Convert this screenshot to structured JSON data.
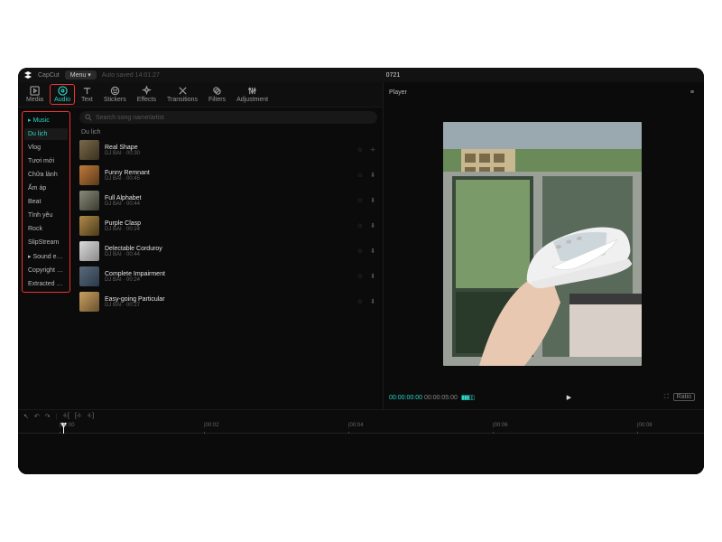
{
  "app_name": "CapCut",
  "menu_label": "Menu ▾",
  "autosave": "Auto saved 14:01:27",
  "project_title": "0721",
  "tabs": [
    {
      "id": "media",
      "label": "Media"
    },
    {
      "id": "audio",
      "label": "Audio"
    },
    {
      "id": "text",
      "label": "Text"
    },
    {
      "id": "stickers",
      "label": "Stickers"
    },
    {
      "id": "effects",
      "label": "Effects"
    },
    {
      "id": "transitions",
      "label": "Transitions"
    },
    {
      "id": "filters",
      "label": "Filters"
    },
    {
      "id": "adjustment",
      "label": "Adjustment"
    }
  ],
  "sidebar": {
    "music_header": "▸ Music",
    "categories": [
      "Du lịch",
      "Vlog",
      "Tươi mới",
      "Chữa lành",
      "Ấm áp",
      "Beat",
      "Tình yêu",
      "Rock",
      "SlipStream"
    ],
    "extras": [
      "▸ Sound effe...",
      "Copyright c...",
      "Extracted a..."
    ]
  },
  "search_placeholder": "Search song name/artist",
  "list_title": "Du lịch",
  "tracks": [
    {
      "name": "Real Shape",
      "artist": "DJ BAI",
      "dur": "00:30",
      "c1": "#7a6a4a",
      "c2": "#3a3020"
    },
    {
      "name": "Funny Remnant",
      "artist": "DJ BAI",
      "dur": "00:45",
      "c1": "#c07a3a",
      "c2": "#5a3a1a"
    },
    {
      "name": "Full Alphabet",
      "artist": "DJ BAI",
      "dur": "00:44",
      "c1": "#8a8a7a",
      "c2": "#3a3a30"
    },
    {
      "name": "Purple Clasp",
      "artist": "DJ BAI",
      "dur": "00:24",
      "c1": "#b08a4a",
      "c2": "#4a3a1a"
    },
    {
      "name": "Delectable Corduroy",
      "artist": "DJ BAI",
      "dur": "00:44",
      "c1": "#dadada",
      "c2": "#8a8a8a"
    },
    {
      "name": "Complete Impairment",
      "artist": "DJ BAI",
      "dur": "00:24",
      "c1": "#5a6a7a",
      "c2": "#2a3a4a"
    },
    {
      "name": "Easy-going Particular",
      "artist": "DJ BAI",
      "dur": "00:27",
      "c1": "#caa060",
      "c2": "#6a5030"
    }
  ],
  "player": {
    "label": "Player",
    "tc_cur": "00:00:00:00",
    "tc_dur": "00:00:05:00",
    "ratio": "Ratio"
  },
  "timeline": {
    "ticks": [
      "00:00",
      "00:02",
      "00:04",
      "00:06",
      "00:08"
    ]
  },
  "selected_category": 0,
  "colors": {
    "accent": "#2bd4c5",
    "hl": "#e33"
  }
}
